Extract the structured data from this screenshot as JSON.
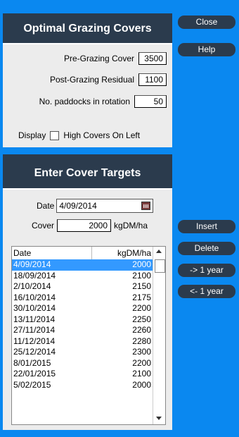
{
  "panel1": {
    "title": "Optimal Grazing Covers",
    "pre_grazing_label": "Pre-Grazing Cover",
    "pre_grazing_value": "3500",
    "post_grazing_label": "Post-Grazing Residual",
    "post_grazing_value": "1100",
    "paddocks_label": "No. paddocks in rotation",
    "paddocks_value": "50",
    "display_label": "Display",
    "high_covers_label": "High Covers On Left",
    "high_covers_checked": false
  },
  "panel2": {
    "title": "Enter Cover Targets",
    "date_label": "Date",
    "date_value": "4/09/2014",
    "cover_label": "Cover",
    "cover_value": "2000",
    "cover_unit": "kgDM/ha",
    "list_headers": [
      "Date",
      "kgDM/ha"
    ],
    "rows": [
      {
        "date": "4/09/2014",
        "value": "2000"
      },
      {
        "date": "18/09/2014",
        "value": "2100"
      },
      {
        "date": "2/10/2014",
        "value": "2150"
      },
      {
        "date": "16/10/2014",
        "value": "2175"
      },
      {
        "date": "30/10/2014",
        "value": "2200"
      },
      {
        "date": "13/11/2014",
        "value": "2250"
      },
      {
        "date": "27/11/2014",
        "value": "2260"
      },
      {
        "date": "11/12/2014",
        "value": "2280"
      },
      {
        "date": "25/12/2014",
        "value": "2300"
      },
      {
        "date": "8/01/2015",
        "value": "2200"
      },
      {
        "date": "22/01/2015",
        "value": "2100"
      },
      {
        "date": "5/02/2015",
        "value": "2000"
      }
    ],
    "selected_row": 0
  },
  "buttons": {
    "close": "Close",
    "help": "Help",
    "insert": "Insert",
    "delete": "Delete",
    "forward_year": "-> 1 year",
    "back_year": "<- 1 year"
  },
  "colors": {
    "background": "#0A88F0",
    "panel_header": "#2B3B4D",
    "selection": "#3399FF"
  }
}
